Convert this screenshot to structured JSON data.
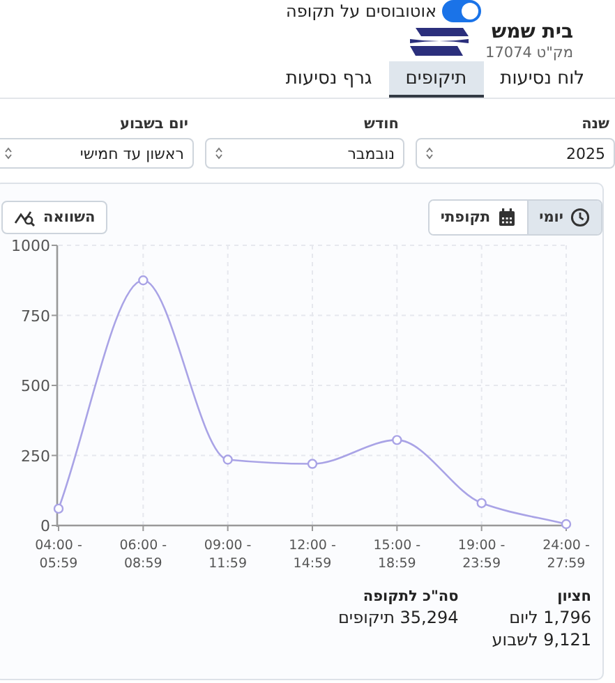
{
  "header": {
    "toggle": {
      "label": "אוטובוסים על תקופה",
      "on": true
    },
    "station": {
      "name": "בית שמש",
      "code": "מק\"ט 17074"
    }
  },
  "tabs": [
    {
      "label": "לוח נסיעות",
      "selected": false
    },
    {
      "label": "תיקופים",
      "selected": true
    },
    {
      "label": "גרף נסיעות",
      "selected": false
    }
  ],
  "filters": [
    {
      "label": "שנה",
      "value": "2025"
    },
    {
      "label": "חודש",
      "value": "נובמבר"
    },
    {
      "label": "יום בשבוע",
      "value": "ראשון עד חמישי"
    }
  ],
  "view_modes": [
    {
      "label": "יומי",
      "kind": "clock",
      "selected": true
    },
    {
      "label": "תקופתי",
      "kind": "calendar",
      "selected": false
    }
  ],
  "compare_button": {
    "label": "השוואה"
  },
  "chart_data": {
    "type": "line",
    "categories": [
      "04:00 - 05:59",
      "06:00 - 08:59",
      "09:00 - 11:59",
      "12:00 - 14:59",
      "15:00 - 18:59",
      "19:00 - 23:59",
      "24:00 - 27:59"
    ],
    "series": [
      {
        "color": "#a9a3e6",
        "marker": "circle",
        "values": [
          60,
          875,
          235,
          220,
          305,
          80,
          5
        ]
      }
    ],
    "grid": true,
    "ylim": [
      0,
      1000
    ],
    "yticks": [
      0,
      250,
      500,
      750,
      1000
    ]
  },
  "stats": [
    {
      "title": "חציון",
      "lines": [
        "1,796 ליום",
        "9,121 לשבוע"
      ]
    },
    {
      "title": "סה\"כ לתקופה",
      "lines": [
        "35,294 תיקופים"
      ]
    }
  ]
}
